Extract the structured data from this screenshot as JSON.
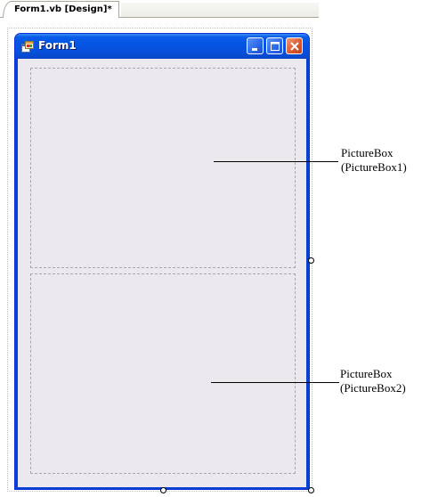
{
  "designer": {
    "tab_title": "Form1.vb [Design]*"
  },
  "form": {
    "title": "Form1",
    "icon": "form-app-icon",
    "caption_buttons": [
      "minimize-icon",
      "maximize-icon",
      "close-icon"
    ]
  },
  "controls": [
    {
      "kind": "PictureBox",
      "name": "PictureBox1"
    },
    {
      "kind": "PictureBox",
      "name": "PictureBox2"
    }
  ],
  "callouts": [
    {
      "line1": "PictureBox",
      "line2": "(PictureBox1)"
    },
    {
      "line1": "PictureBox",
      "line2": "(PictureBox2)"
    }
  ],
  "colors": {
    "title_bar": "#0554e3",
    "window_border": "#0842d5",
    "client_area": "#ebe9ed",
    "close_button": "#dc5a31"
  }
}
